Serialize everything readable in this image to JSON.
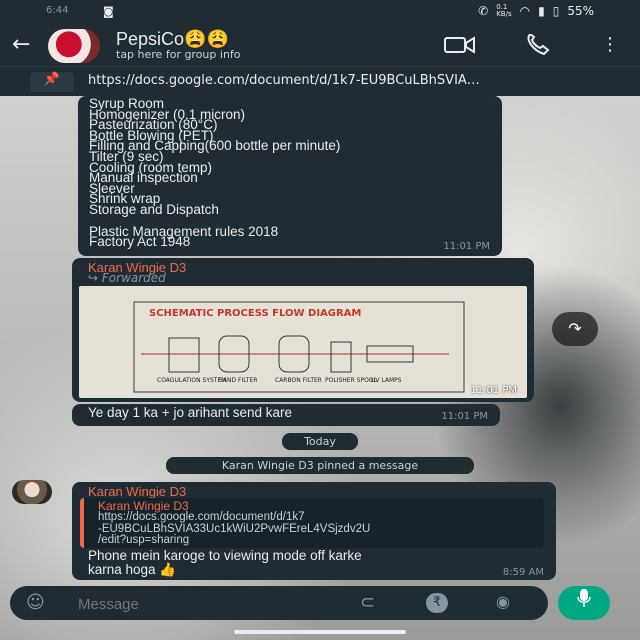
{
  "status": {
    "time": "6:44",
    "speed": "0.1\nKB/s",
    "battery": "55%"
  },
  "header": {
    "group_name": "PepsiCo😩😩",
    "subtitle": "tap here for group info"
  },
  "pinned": {
    "url": "https://docs.google.com/document/d/1k7-EU9BCuLBhSVIA…"
  },
  "messages": {
    "m1": {
      "lines": [
        "Syrup Room",
        "Homogenizer (0.1 micron)",
        "Pasteurization (80°C)",
        "Bottle Blowing (PET)",
        "Filling and Capping(600 bottle per minute)",
        "Tilter (9 sec)",
        "Cooling (room temp)",
        "Manual inspection",
        "Sleever",
        "Shrink wrap",
        "Storage and Dispatch"
      ],
      "extra": [
        "Plastic Management rules 2018",
        "Factory Act 1948"
      ],
      "time": "11:01 PM"
    },
    "m2": {
      "sender": "Karan Wingie D3",
      "forwarded": "Forwarded",
      "diagram_title": "SCHEMATIC PROCESS FLOW DIAGRAM",
      "diagram_labels": [
        "COAGULATION SYSTEM",
        "SAND FILTER",
        "CARBON FILTER",
        "POLISHER SPOOL",
        "UV LAMPS"
      ],
      "time": "11:01 PM"
    },
    "m3": {
      "text": "Ye day 1 ka + jo arihant send kare",
      "time": "11:01 PM"
    },
    "today": "Today",
    "system_pin": "Karan Wingie D3 pinned a message",
    "m4": {
      "sender": "Karan Wingie D3",
      "quote_sender": "Karan Wingie D3",
      "quote_lines": [
        "https://docs.google.com/document/d/1k7",
        "-EU9BCuLBhSVIA33Uc1kWiU2PvwFEreL4VSjzdv2U",
        "/edit?usp=sharing"
      ],
      "text_lines": [
        "Phone mein karoge to viewing mode off karke",
        "karna hoga 👍"
      ],
      "time": "8:59 AM"
    }
  },
  "input": {
    "placeholder": "Message"
  },
  "colors": {
    "accent": "#00a884",
    "sender": "#f2694a",
    "bubble": "#1f2c34"
  }
}
